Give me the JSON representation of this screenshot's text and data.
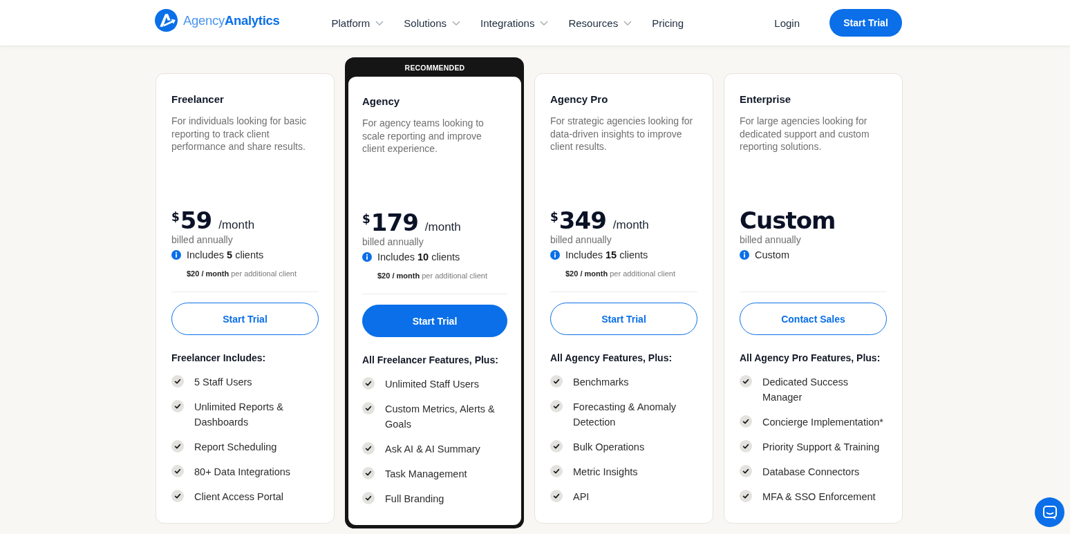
{
  "header": {
    "logo_text": "Agency**Analytics**",
    "nav": [
      {
        "label": "Platform",
        "dropdown": true
      },
      {
        "label": "Solutions",
        "dropdown": true
      },
      {
        "label": "Integrations",
        "dropdown": true
      },
      {
        "label": "Resources",
        "dropdown": true
      },
      {
        "label": "Pricing",
        "dropdown": false
      }
    ],
    "login": "Login",
    "cta": "Start Trial"
  },
  "plans": [
    {
      "name": "Freelancer",
      "description": "For individuals looking for basic reporting to track client performance and share results.",
      "price": {
        "currency": "$",
        "amount": "59",
        "period": "/month"
      },
      "billing": "billed annually",
      "includes": "Includes **5** clients",
      "extra": "**$20 / month** per additional client",
      "button": {
        "label": "Start Trial",
        "filled": false
      },
      "features_heading": "Freelancer Includes:",
      "features": [
        "5 Staff Users",
        "Unlimited Reports & Dashboards",
        "Report Scheduling",
        "80+ Data Integrations",
        "Client Access Portal"
      ]
    },
    {
      "badge": "RECOMMENDED",
      "name": "Agency",
      "description": "For agency teams looking to scale reporting and improve client experience.",
      "price": {
        "currency": "$",
        "amount": "179",
        "period": "/month"
      },
      "billing": "billed annually",
      "includes": "Includes **10** clients",
      "extra": "**$20 / month** per additional client",
      "button": {
        "label": "Start Trial",
        "filled": true
      },
      "features_heading": "All Freelancer Features, Plus:",
      "features": [
        "Unlimited Staff Users",
        "Custom Metrics, Alerts & Goals",
        "Ask AI & AI Summary",
        "Task Management",
        "Full Branding"
      ]
    },
    {
      "name": "Agency Pro",
      "description": "For strategic agencies looking for data-driven insights to improve client results.",
      "price": {
        "currency": "$",
        "amount": "349",
        "period": "/month"
      },
      "billing": "billed annually",
      "includes": "Includes **15** clients",
      "extra": "**$20 / month** per additional client",
      "button": {
        "label": "Start Trial",
        "filled": false
      },
      "features_heading": "All Agency Features, Plus:",
      "features": [
        "Benchmarks",
        "Forecasting & Anomaly Detection",
        "Bulk Operations",
        "Metric Insights",
        "API"
      ]
    },
    {
      "name": "Enterprise",
      "description": "For large agencies looking for dedicated support and custom reporting solutions.",
      "price": {
        "amount": "Custom"
      },
      "billing": "billed annually",
      "includes": "Custom",
      "button": {
        "label": "Contact Sales",
        "filled": false
      },
      "features_heading": "All Agency Pro Features, Plus:",
      "features": [
        "Dedicated Success Manager",
        "Concierge Implementation*",
        "Priority Support & Training",
        "Database Connectors",
        "MFA & SSO Enforcement"
      ]
    }
  ]
}
